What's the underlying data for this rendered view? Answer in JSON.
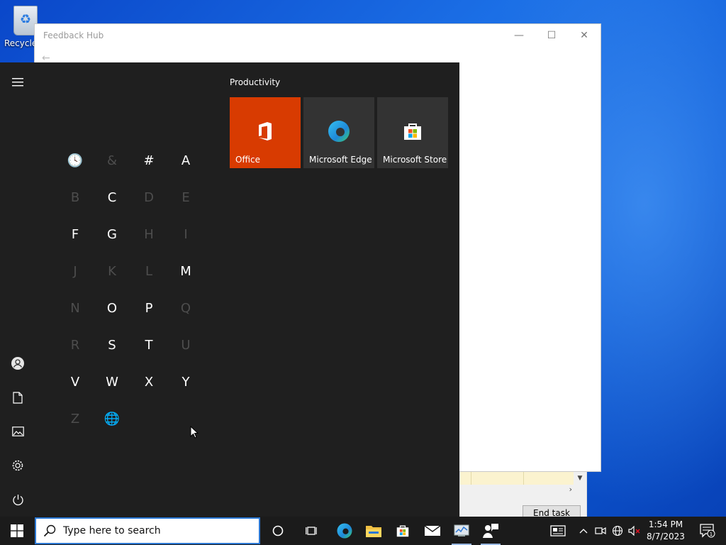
{
  "desktop": {
    "recycle_bin_label": "Recycle Bin"
  },
  "feedback_hub": {
    "title": "Feedback Hub",
    "minimize": "—",
    "maximize": "☐",
    "close": "✕",
    "back": "←"
  },
  "task_manager": {
    "end_task_label": "End task"
  },
  "start_menu": {
    "rail": {
      "hamburger": "hamburger-menu-icon",
      "user": "user-icon",
      "documents": "document-icon",
      "pictures": "pictures-icon",
      "settings": "gear-icon",
      "power": "power-icon"
    },
    "alphabet": [
      {
        "label": "🕓",
        "active": false,
        "name": "recent"
      },
      {
        "label": "&",
        "active": false,
        "name": "ampersand"
      },
      {
        "label": "#",
        "active": true,
        "name": "hash"
      },
      {
        "label": "A",
        "active": true,
        "name": "a"
      },
      {
        "label": "B",
        "active": false,
        "name": "b"
      },
      {
        "label": "C",
        "active": true,
        "name": "c"
      },
      {
        "label": "D",
        "active": false,
        "name": "d"
      },
      {
        "label": "E",
        "active": false,
        "name": "e"
      },
      {
        "label": "F",
        "active": true,
        "name": "f"
      },
      {
        "label": "G",
        "active": true,
        "name": "g"
      },
      {
        "label": "H",
        "active": false,
        "name": "h"
      },
      {
        "label": "I",
        "active": false,
        "name": "i"
      },
      {
        "label": "J",
        "active": false,
        "name": "j"
      },
      {
        "label": "K",
        "active": false,
        "name": "k"
      },
      {
        "label": "L",
        "active": false,
        "name": "l"
      },
      {
        "label": "M",
        "active": true,
        "name": "m"
      },
      {
        "label": "N",
        "active": false,
        "name": "n"
      },
      {
        "label": "O",
        "active": true,
        "name": "o"
      },
      {
        "label": "P",
        "active": true,
        "name": "p"
      },
      {
        "label": "Q",
        "active": false,
        "name": "q"
      },
      {
        "label": "R",
        "active": false,
        "name": "r"
      },
      {
        "label": "S",
        "active": true,
        "name": "s"
      },
      {
        "label": "T",
        "active": true,
        "name": "t"
      },
      {
        "label": "U",
        "active": false,
        "name": "u"
      },
      {
        "label": "V",
        "active": true,
        "name": "v"
      },
      {
        "label": "W",
        "active": true,
        "name": "w"
      },
      {
        "label": "X",
        "active": true,
        "name": "x"
      },
      {
        "label": "Y",
        "active": true,
        "name": "y"
      },
      {
        "label": "Z",
        "active": false,
        "name": "z"
      },
      {
        "label": "🌐",
        "active": false,
        "name": "globe"
      }
    ],
    "tiles_group": "Productivity",
    "tiles": [
      {
        "label": "Office",
        "icon": "office-icon",
        "color": "#d83b01"
      },
      {
        "label": "Microsoft Edge",
        "icon": "edge-icon",
        "color": "#333333"
      },
      {
        "label": "Microsoft Store",
        "icon": "store-icon",
        "color": "#333333"
      }
    ]
  },
  "taskbar": {
    "search_placeholder": "Type here to search",
    "apps": [
      "cortana-icon",
      "task-view-icon",
      "edge-icon",
      "file-explorer-icon",
      "store-icon",
      "mail-icon",
      "task-manager-icon",
      "feedback-hub-icon"
    ],
    "tray": [
      "news-icon",
      "chevron-up-icon",
      "meet-now-icon",
      "network-icon",
      "volume-muted-icon"
    ],
    "time": "1:54 PM",
    "date": "8/7/2023",
    "notification_count": "1"
  },
  "colors": {
    "accent": "#2b78d4",
    "start_bg": "#1f1f1f",
    "office_tile": "#d83b01",
    "taskbar_bg": "#1b1b1b"
  }
}
